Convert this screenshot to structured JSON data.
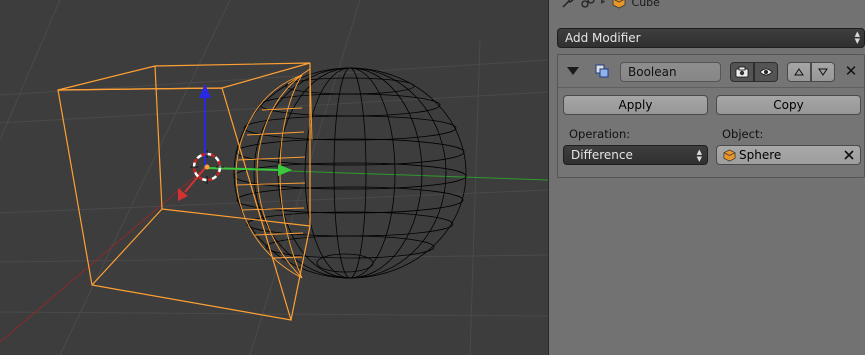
{
  "breadcrumb": {
    "items": [
      {
        "icon": "wrench-icon"
      },
      {
        "icon": "link-icon"
      },
      {
        "label": "Cube",
        "icon": "cube-icon"
      }
    ]
  },
  "properties": {
    "add_modifier_label": "Add Modifier",
    "modifier": {
      "name": "Boolean",
      "apply_label": "Apply",
      "copy_label": "Copy",
      "operation_label": "Operation:",
      "operation_value": "Difference",
      "object_label": "Object:",
      "object_value": "Sphere"
    }
  },
  "colors": {
    "viewport_bg": "#3d3d3d",
    "panel_bg": "#727272",
    "selected_wire": "#ffa033",
    "sphere_wire": "#000000",
    "x_axis": "#d23232",
    "y_axis": "#3cc83c",
    "z_axis": "#2828e6"
  }
}
